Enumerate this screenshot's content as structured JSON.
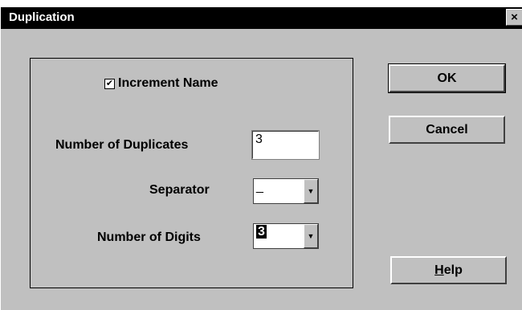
{
  "window": {
    "title": "Duplication",
    "close_glyph": "×"
  },
  "options": {
    "increment_name": {
      "label": "Increment Name",
      "checked": true,
      "check_glyph": "✔"
    }
  },
  "fields": {
    "num_duplicates": {
      "label": "Number of Duplicates",
      "value": "3"
    },
    "separator": {
      "label": "Separator",
      "value": "_"
    },
    "num_digits": {
      "label": "Number of Digits",
      "value": "3"
    }
  },
  "buttons": {
    "ok": "OK",
    "cancel": "Cancel",
    "help_mnemonic": "H",
    "help_rest": "elp"
  },
  "icons": {
    "dropdown_arrow": "▼"
  }
}
